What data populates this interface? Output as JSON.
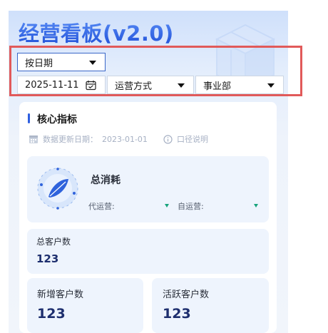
{
  "header": {
    "title": "经营看板(v2.0)"
  },
  "filters": {
    "period": "按日期",
    "date": "2025-11-11",
    "operation_mode": "运营方式",
    "department": "事业部"
  },
  "core": {
    "title": "核心指标",
    "update_label": "数据更新日期：",
    "update_date": "2023-01-01",
    "caliber_label": "口径说明"
  },
  "spend": {
    "title": "总消耗",
    "agent_label": "代运营:",
    "self_label": "自运营:"
  },
  "customers": {
    "total_label": "总客户数",
    "total_value": "123",
    "new_label": "新增客户数",
    "new_value": "123",
    "active_label": "活跃客户数",
    "active_value": "123"
  },
  "colors": {
    "accent": "#2f5fe0",
    "highlight": "#e15a5a",
    "down": "#17a37c"
  }
}
